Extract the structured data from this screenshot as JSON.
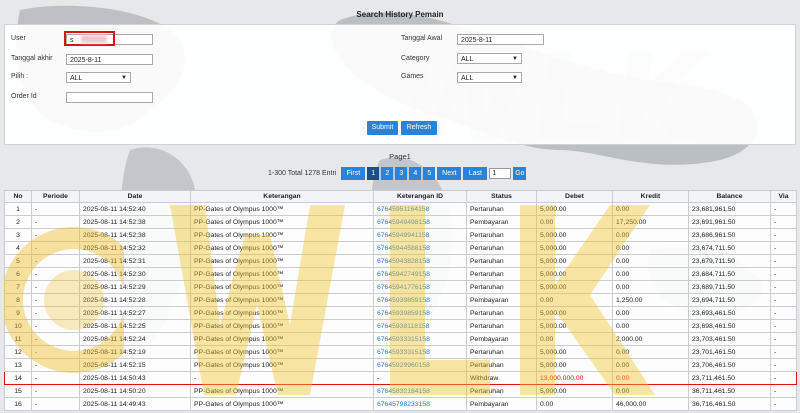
{
  "page": {
    "title": "Search History Pemain",
    "page_label": "Page1"
  },
  "filters": {
    "user_label": "User",
    "user_value": "s",
    "tanggal_awal_label": "Tanggal Awal",
    "tanggal_awal_value": "2025-8-11",
    "tanggal_akhir_label": "Tanggal akhir",
    "tanggal_akhir_value": "2025-8-11",
    "category_label": "Category",
    "category_value": "ALL",
    "pilih_label": "Pilih :",
    "pilih_value": "ALL",
    "games_label": "Games",
    "games_value": "ALL",
    "order_label": "Order Id",
    "order_value": "",
    "submit_label": "Submit",
    "refresh_label": "Refresh"
  },
  "pager": {
    "total_text": "1-300 Total 1278 Entri",
    "first": "First",
    "pages": [
      "1",
      "2",
      "3",
      "4",
      "5"
    ],
    "next": "Next",
    "last": "Last",
    "input_value": "1",
    "go": "Go"
  },
  "table": {
    "headers": [
      "No",
      "Periode",
      "Date",
      "Keterangan",
      "Keterangan ID",
      "Status",
      "Debet",
      "Kredit",
      "Balance",
      "Via"
    ],
    "rows": [
      [
        "1",
        "-",
        "2025-08-11 14:52:40",
        "PP-Gates of Olympus 1000™",
        "67645951164158",
        "Pertaruhan",
        "5,000.00",
        "0.00",
        "23,681,961.50",
        "-"
      ],
      [
        "2",
        "-",
        "2025-08-11 14:52:38",
        "PP-Gates of Olympus 1000™",
        "67645949498158",
        "Pembayaran",
        "0.00",
        "17,250.00",
        "23,691,961.50",
        "-"
      ],
      [
        "3",
        "-",
        "2025-08-11 14:52:38",
        "PP-Gates of Olympus 1000™",
        "67645949941158",
        "Pertaruhan",
        "5,000.00",
        "0.00",
        "23,686,961.50",
        "-"
      ],
      [
        "4",
        "-",
        "2025-08-11 14:52:32",
        "PP-Gates of Olympus 1000™",
        "67645944588158",
        "Pertaruhan",
        "5,000.00",
        "0.00",
        "23,674,711.50",
        "-"
      ],
      [
        "5",
        "-",
        "2025-08-11 14:52:31",
        "PP-Gates of Olympus 1000™",
        "67645943828158",
        "Pertaruhan",
        "5,000.00",
        "0.00",
        "23,679,711.50",
        "-"
      ],
      [
        "6",
        "-",
        "2025-08-11 14:52:30",
        "PP-Gates of Olympus 1000™",
        "67645942749158",
        "Pertaruhan",
        "5,000.00",
        "0.00",
        "23,684,711.50",
        "-"
      ],
      [
        "7",
        "-",
        "2025-08-11 14:52:29",
        "PP-Gates of Olympus 1000™",
        "67645941776158",
        "Pertaruhan",
        "5,000.00",
        "0.00",
        "23,689,711.50",
        "-"
      ],
      [
        "8",
        "-",
        "2025-08-11 14:52:28",
        "PP-Gates of Olympus 1000™",
        "67645939859158",
        "Pembayaran",
        "0.00",
        "1,250.00",
        "23,694,711.50",
        "-"
      ],
      [
        "9",
        "-",
        "2025-08-11 14:52:27",
        "PP-Gates of Olympus 1000™",
        "67645939859158",
        "Pertaruhan",
        "5,000.00",
        "0.00",
        "23,693,461.50",
        "-"
      ],
      [
        "10",
        "-",
        "2025-08-11 14:52:25",
        "PP-Gates of Olympus 1000™",
        "67645938118158",
        "Pertaruhan",
        "5,000.00",
        "0.00",
        "23,698,461.50",
        "-"
      ],
      [
        "11",
        "-",
        "2025-08-11 14:52:24",
        "PP-Gates of Olympus 1000™",
        "67645933315158",
        "Pembayaran",
        "0.00",
        "2,000.00",
        "23,703,461.50",
        "-"
      ],
      [
        "12",
        "-",
        "2025-08-11 14:52:19",
        "PP-Gates of Olympus 1000™",
        "67645933315158",
        "Pertaruhan",
        "5,000.00",
        "0.00",
        "23,701,461.50",
        "-"
      ],
      [
        "13",
        "-",
        "2025-08-11 14:52:15",
        "PP-Gates of Olympus 1000™",
        "67645929960158",
        "Pertaruhan",
        "5,000.00",
        "0.00",
        "23,706,461.50",
        "-"
      ],
      [
        "14",
        "-",
        "2025-08-11 14:50:43",
        "-",
        "-",
        "Withdraw",
        "13,000,000.00",
        "0.00",
        "23,711,461.50",
        "-"
      ],
      [
        "15",
        "-",
        "2025-08-11 14:50:20",
        "PP-Gates of Olympus 1000™",
        "67645832184158",
        "Pertaruhan",
        "5,000.00",
        "0.00",
        "36,711,461.50",
        "-"
      ],
      [
        "16",
        "-",
        "2025-08-11 14:49:43",
        "PP-Gates of Olympus 1000™",
        "67645798233158",
        "Pembayaran",
        "0.00",
        "46,000.00",
        "36,716,461.50",
        "-"
      ]
    ],
    "highlight_row_index": 13,
    "highlight_color": "#dd1111",
    "link_color": "#2a7ad0",
    "accent_color": "#2a83d8"
  }
}
